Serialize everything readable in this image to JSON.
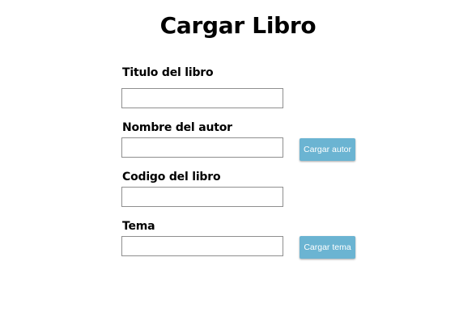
{
  "page": {
    "title": "Cargar Libro"
  },
  "form": {
    "titulo": {
      "label": "Titulo del libro",
      "value": ""
    },
    "autor": {
      "label": "Nombre del autor",
      "value": "",
      "button_label": "Cargar autor"
    },
    "codigo": {
      "label": "Codigo del libro",
      "value": ""
    },
    "tema": {
      "label": "Tema",
      "value": "",
      "button_label": "Cargar tema"
    }
  },
  "colors": {
    "button_bg": "#6bb4d2",
    "button_text": "#ffffff",
    "field_border": "#8f8f8f"
  }
}
